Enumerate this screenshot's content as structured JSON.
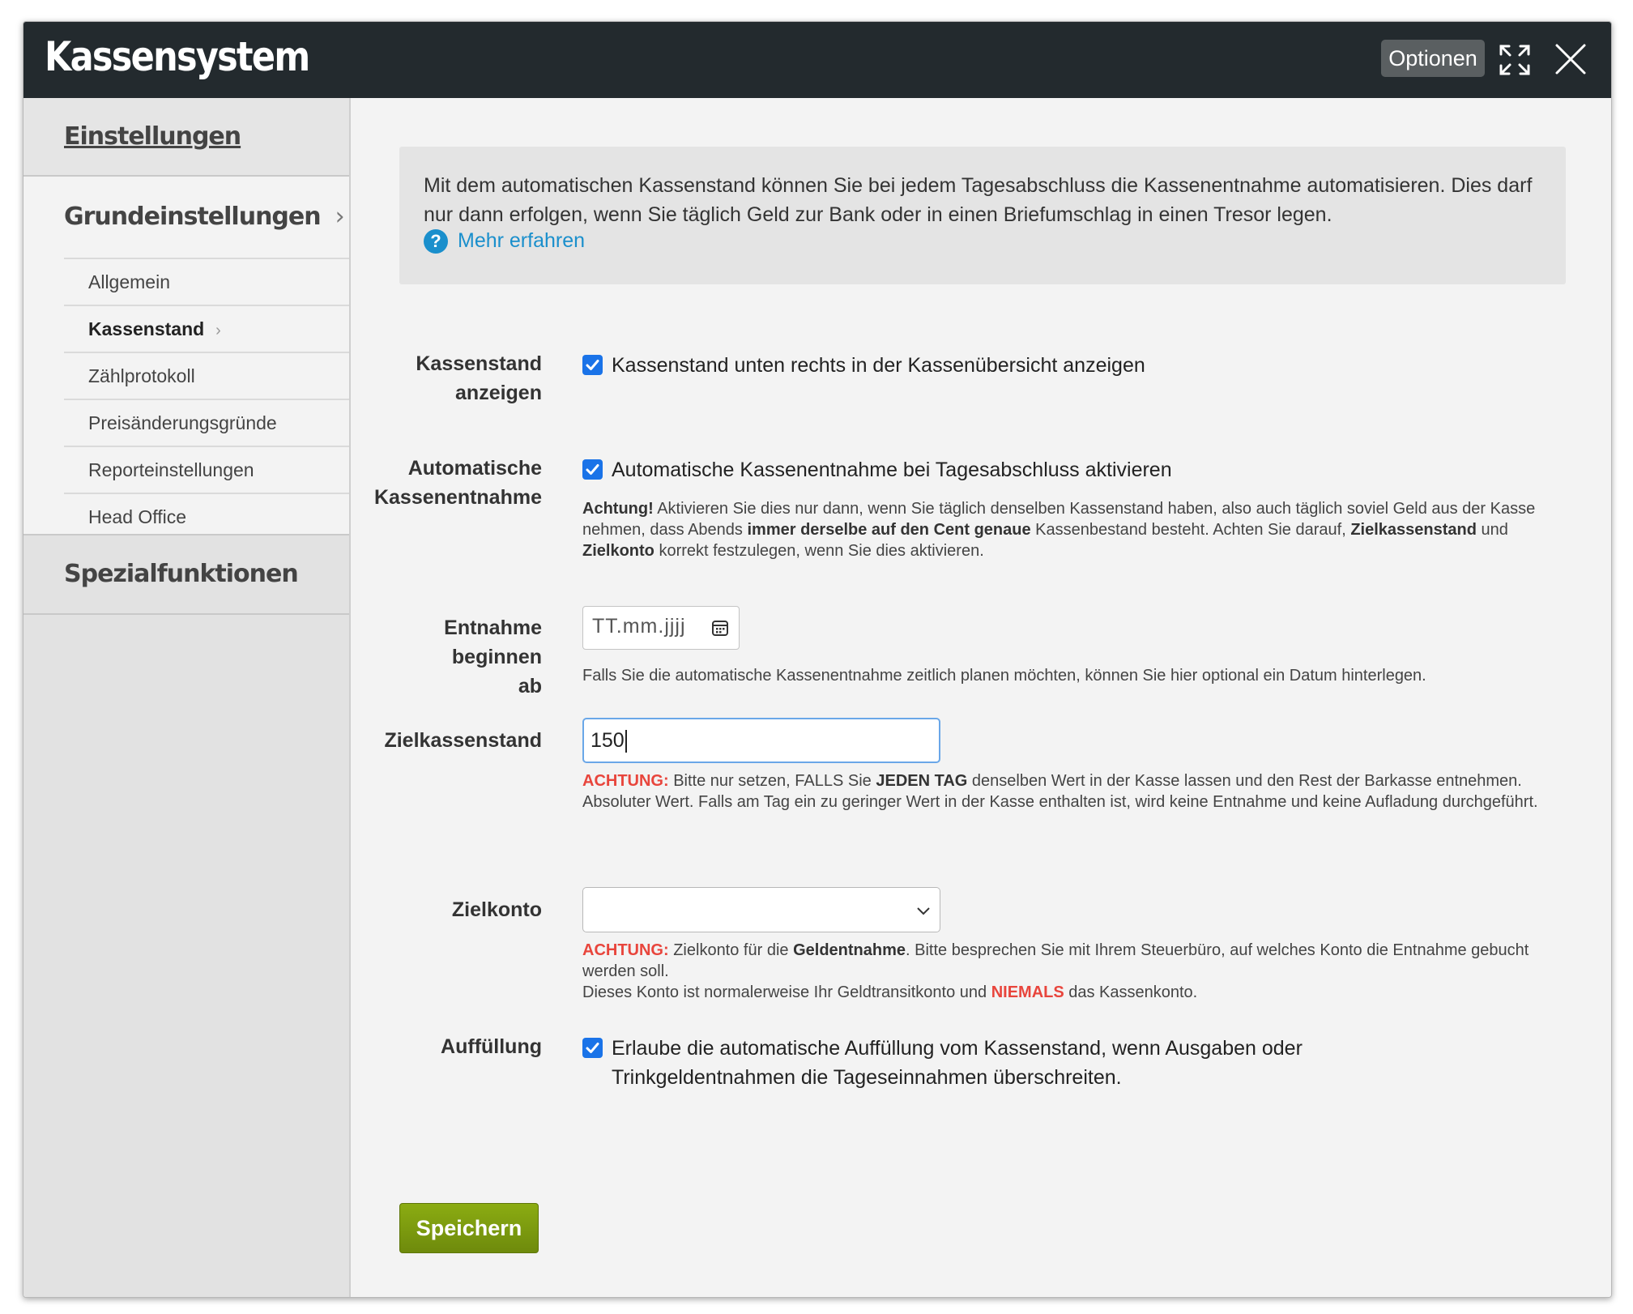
{
  "window": {
    "title": "Kassensystem",
    "options_label": "Optionen"
  },
  "sidebar": {
    "settings_heading": "Einstellungen",
    "section_heading": "Grundeinstellungen",
    "section_chevron": "›",
    "items": [
      {
        "label": "Allgemein"
      },
      {
        "label": "Kassenstand",
        "active": true
      },
      {
        "label": "Zählprotokoll"
      },
      {
        "label": "Preisänderungsgründe"
      },
      {
        "label": "Reporteinstellungen"
      },
      {
        "label": "Head Office"
      }
    ],
    "special_heading": "Spezialfunktionen"
  },
  "info": {
    "text": "Mit dem automatischen Kassenstand können Sie bei jedem Tagesabschluss die Kassenentnahme automatisieren. Dies darf nur dann erfolgen, wenn Sie täglich Geld zur Bank oder in einen Briefumschlag in einen Tresor legen.",
    "link": "Mehr erfahren",
    "help_icon": "?"
  },
  "form": {
    "show_balance": {
      "label_line1": "Kassenstand",
      "label_line2": "anzeigen",
      "checkbox_label": "Kassenstand unten rechts in der Kassenübersicht anzeigen",
      "checked": true
    },
    "auto_withdrawal": {
      "label_line1": "Automatische",
      "label_line2": "Kassenentnahme",
      "checkbox_label": "Automatische Kassenentnahme bei Tagesabschluss aktivieren",
      "checked": true,
      "note_warn": "Achtung!",
      "note_1": " Aktivieren Sie dies nur dann, wenn Sie täglich denselben Kassenstand haben, also auch täglich soviel Geld aus der Kasse nehmen, dass Abends ",
      "note_bold1": "immer derselbe auf den Cent genaue",
      "note_2": " Kassenbestand besteht. Achten Sie darauf, ",
      "note_bold2": "Zielkassenstand",
      "note_3": " und ",
      "note_bold3": "Zielkonto",
      "note_4": " korrekt festzulegen, wenn Sie dies aktivieren."
    },
    "start_date": {
      "label_line1": "Entnahme beginnen",
      "label_line2": "ab",
      "placeholder": "TT.mm.jjjj",
      "note": "Falls Sie die automatische Kassenentnahme zeitlich planen möchten, können Sie hier optional ein Datum hinterlegen."
    },
    "target_balance": {
      "label": "Zielkassenstand",
      "value": "150",
      "warn": "ACHTUNG:",
      "note_1": " Bitte nur setzen, FALLS Sie ",
      "note_bold": "JEDEN TAG",
      "note_2": " denselben Wert in der Kasse lassen und den Rest der Barkasse entnehmen.",
      "note_3": "Absoluter Wert. Falls am Tag ein zu geringer Wert in der Kasse enthalten ist, wird keine Entnahme und keine Aufladung durchgeführt."
    },
    "target_account": {
      "label": "Zielkonto",
      "selected": "",
      "warn": "ACHTUNG:",
      "note_1": " Zielkonto für die ",
      "note_bold": "Geldentnahme",
      "note_2": ". Bitte besprechen Sie mit Ihrem Steuerbüro, auf welches Konto die Entnahme gebucht werden soll.",
      "note_3": "Dieses Konto ist normalerweise Ihr Geldtransitkonto und ",
      "note_red": "NIEMALS",
      "note_4": " das Kassenkonto."
    },
    "refill": {
      "label": "Auffüllung",
      "checkbox_line1": "Erlaube die automatische Auffüllung vom Kassenstand, wenn Ausgaben oder",
      "checkbox_line2": "Trinkgeldentnahmen die Tageseinnahmen überschreiten.",
      "checked": true
    },
    "save_label": "Speichern"
  },
  "colors": {
    "titlebar": "#232a2e",
    "accent": "#1a73e8",
    "link": "#1a8fcc",
    "warning": "#e8453c",
    "save_button": "#7a9a10"
  },
  "icons": {
    "expand": "expand-icon",
    "close": "close-icon",
    "calendar": "calendar-icon",
    "chevron": "chevron-down-icon",
    "checkbox": "check-icon"
  }
}
